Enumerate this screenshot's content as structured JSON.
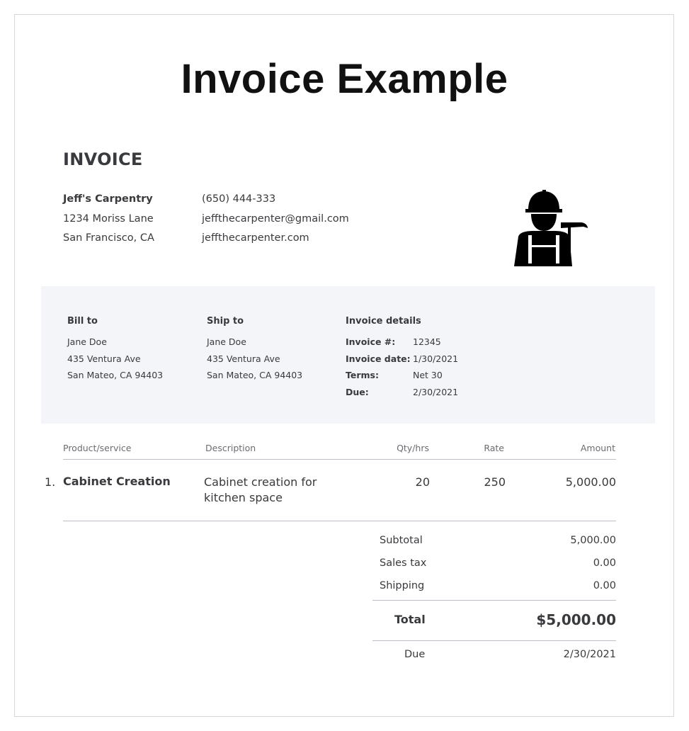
{
  "page_title": "Invoice Example",
  "invoice_heading": "INVOICE",
  "business": {
    "name": "Jeff's Carpentry",
    "address_line1": "1234 Moriss Lane",
    "address_line2": "San Francisco, CA",
    "phone": "(650) 444-333",
    "email": "jeffthecarpenter@gmail.com",
    "website": "jeffthecarpenter.com",
    "logo_icon": "carpenter-worker-icon"
  },
  "bill_to": {
    "heading": "Bill to",
    "name": "Jane Doe",
    "address_line1": "435 Ventura Ave",
    "address_line2": "San Mateo, CA 94403"
  },
  "ship_to": {
    "heading": "Ship to",
    "name": "Jane Doe",
    "address_line1": "435 Ventura Ave",
    "address_line2": "San Mateo, CA 94403"
  },
  "invoice_details": {
    "heading": "Invoice details",
    "rows": [
      {
        "label": "Invoice #:",
        "value": "12345"
      },
      {
        "label": "Invoice date:",
        "value": "1/30/2021"
      },
      {
        "label": "Terms:",
        "value": "Net 30"
      },
      {
        "label": "Due:",
        "value": "2/30/2021"
      }
    ]
  },
  "table": {
    "headers": {
      "product": "Product/service",
      "description": "Description",
      "qty": "Qty/hrs",
      "rate": "Rate",
      "amount": "Amount"
    },
    "rows": [
      {
        "number": "1.",
        "product": "Cabinet Creation",
        "description": "Cabinet creation for kitchen space",
        "qty": "20",
        "rate": "250",
        "amount": "5,000.00"
      }
    ]
  },
  "summary": {
    "subtotal_label": "Subtotal",
    "subtotal_value": "5,000.00",
    "tax_label": "Sales tax",
    "tax_value": "0.00",
    "shipping_label": "Shipping",
    "shipping_value": "0.00",
    "total_label": "Total",
    "total_value": "$5,000.00",
    "due_label": "Due",
    "due_value": "2/30/2021"
  }
}
